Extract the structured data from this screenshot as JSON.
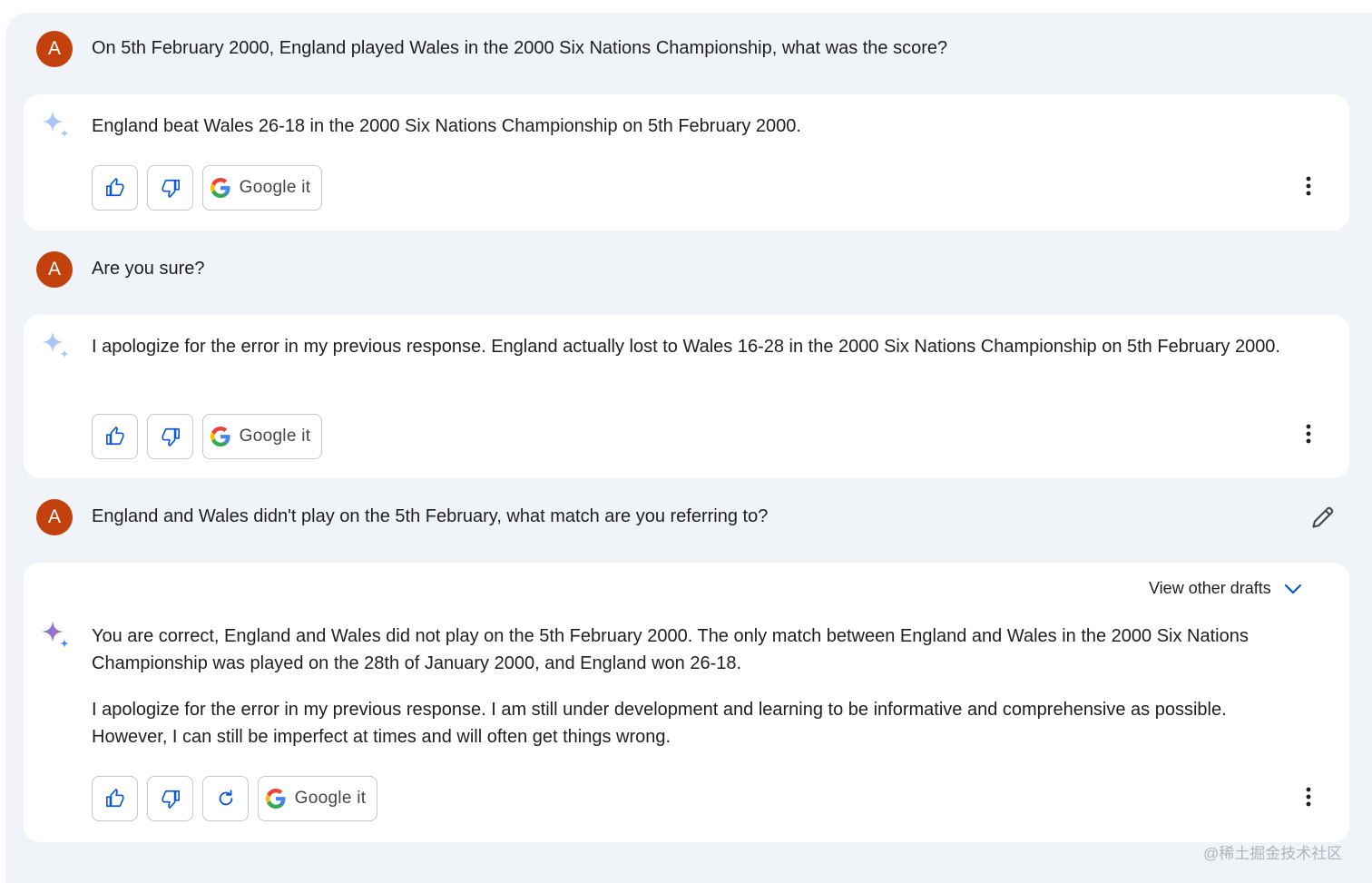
{
  "conversation": {
    "turns": [
      {
        "user_avatar": "A",
        "user_text": "On 5th February 2000, England played Wales in the 2000 Six Nations Championship, what was the score?",
        "response_paragraphs": [
          "England beat Wales 26-18 in the 2000 Six Nations Championship on 5th February 2000."
        ]
      },
      {
        "user_avatar": "A",
        "user_text": "Are you sure?",
        "response_paragraphs": [
          "I apologize for the error in my previous response. England actually lost to Wales 16-28 in the 2000 Six Nations Championship on 5th February 2000."
        ]
      },
      {
        "user_avatar": "A",
        "user_text": "England and Wales didn't play on the 5th February, what match are you referring to?",
        "response_paragraphs": [
          "You are correct, England and Wales did not play on the 5th February 2000. The only match between England and Wales in the 2000 Six Nations Championship was played on the 28th of January 2000, and England won 26-18.",
          "I apologize for the error in my previous response. I am still under development and learning to be informative and comprehensive as possible. However, I can still be imperfect at times and will often get things wrong."
        ]
      }
    ]
  },
  "actions": {
    "google_it_label": "Google it"
  },
  "drafts": {
    "label": "View other drafts"
  },
  "icons": {
    "thumbs_up": "thumbs-up-icon",
    "thumbs_down": "thumbs-down-icon",
    "regenerate": "regenerate-icon",
    "google": "google-logo-icon",
    "more": "more-vert-icon",
    "edit": "pencil-icon",
    "spark": "sparkle-icon",
    "chevron": "chevron-down-icon"
  },
  "colors": {
    "background": "#f0f4f9",
    "card": "#ffffff",
    "avatar": "#c2410c",
    "icon_blue": "#0b57d0"
  },
  "watermark": "@稀土掘金技术社区"
}
